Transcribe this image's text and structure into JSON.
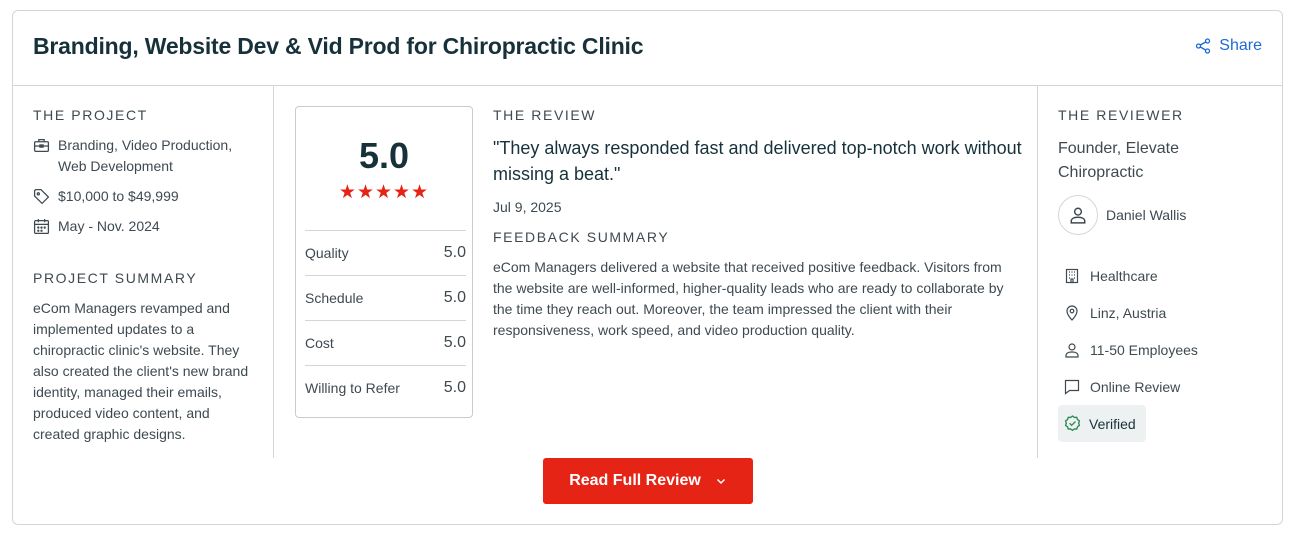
{
  "header": {
    "title": "Branding, Website Dev & Vid Prod for Chiropractic Clinic",
    "share_label": "Share"
  },
  "project": {
    "section_label": "THE PROJECT",
    "services": "Branding, Video Production, Web Development",
    "budget": "$10,000 to $49,999",
    "dates": "May - Nov. 2024",
    "summary_label": "PROJECT SUMMARY",
    "summary": "eCom Managers revamped and implemented updates to a chiropractic clinic's website. They also created the client's new brand identity, managed their emails, produced video content, and created graphic designs."
  },
  "rating": {
    "overall": "5.0",
    "stars": "★★★★★",
    "scores": [
      {
        "label": "Quality",
        "value": "5.0"
      },
      {
        "label": "Schedule",
        "value": "5.0"
      },
      {
        "label": "Cost",
        "value": "5.0"
      },
      {
        "label": "Willing to Refer",
        "value": "5.0"
      }
    ]
  },
  "review": {
    "section_label": "THE REVIEW",
    "quote": "\"They always responded fast and delivered top-notch work without missing a beat.\"",
    "date": "Jul 9, 2025",
    "feedback_label": "FEEDBACK SUMMARY",
    "feedback": "eCom Managers delivered a website that received positive feedback. Visitors from the website are well-informed, higher-quality leads who are ready to collaborate by the time they reach out. Moreover, the team impressed the client with their responsiveness, work speed, and video production quality."
  },
  "reviewer": {
    "section_label": "THE REVIEWER",
    "title": "Founder, Elevate Chiropractic",
    "name": "Daniel Wallis",
    "industry": "Healthcare",
    "location": "Linz, Austria",
    "size": "11-50 Employees",
    "review_type": "Online Review",
    "verified": "Verified"
  },
  "cta": {
    "read_full_review": "Read Full Review"
  },
  "colors": {
    "accent_red": "#e62415",
    "link_blue": "#1c6ad6",
    "verified_green": "#2e8b57",
    "text_dark": "#17313b"
  }
}
